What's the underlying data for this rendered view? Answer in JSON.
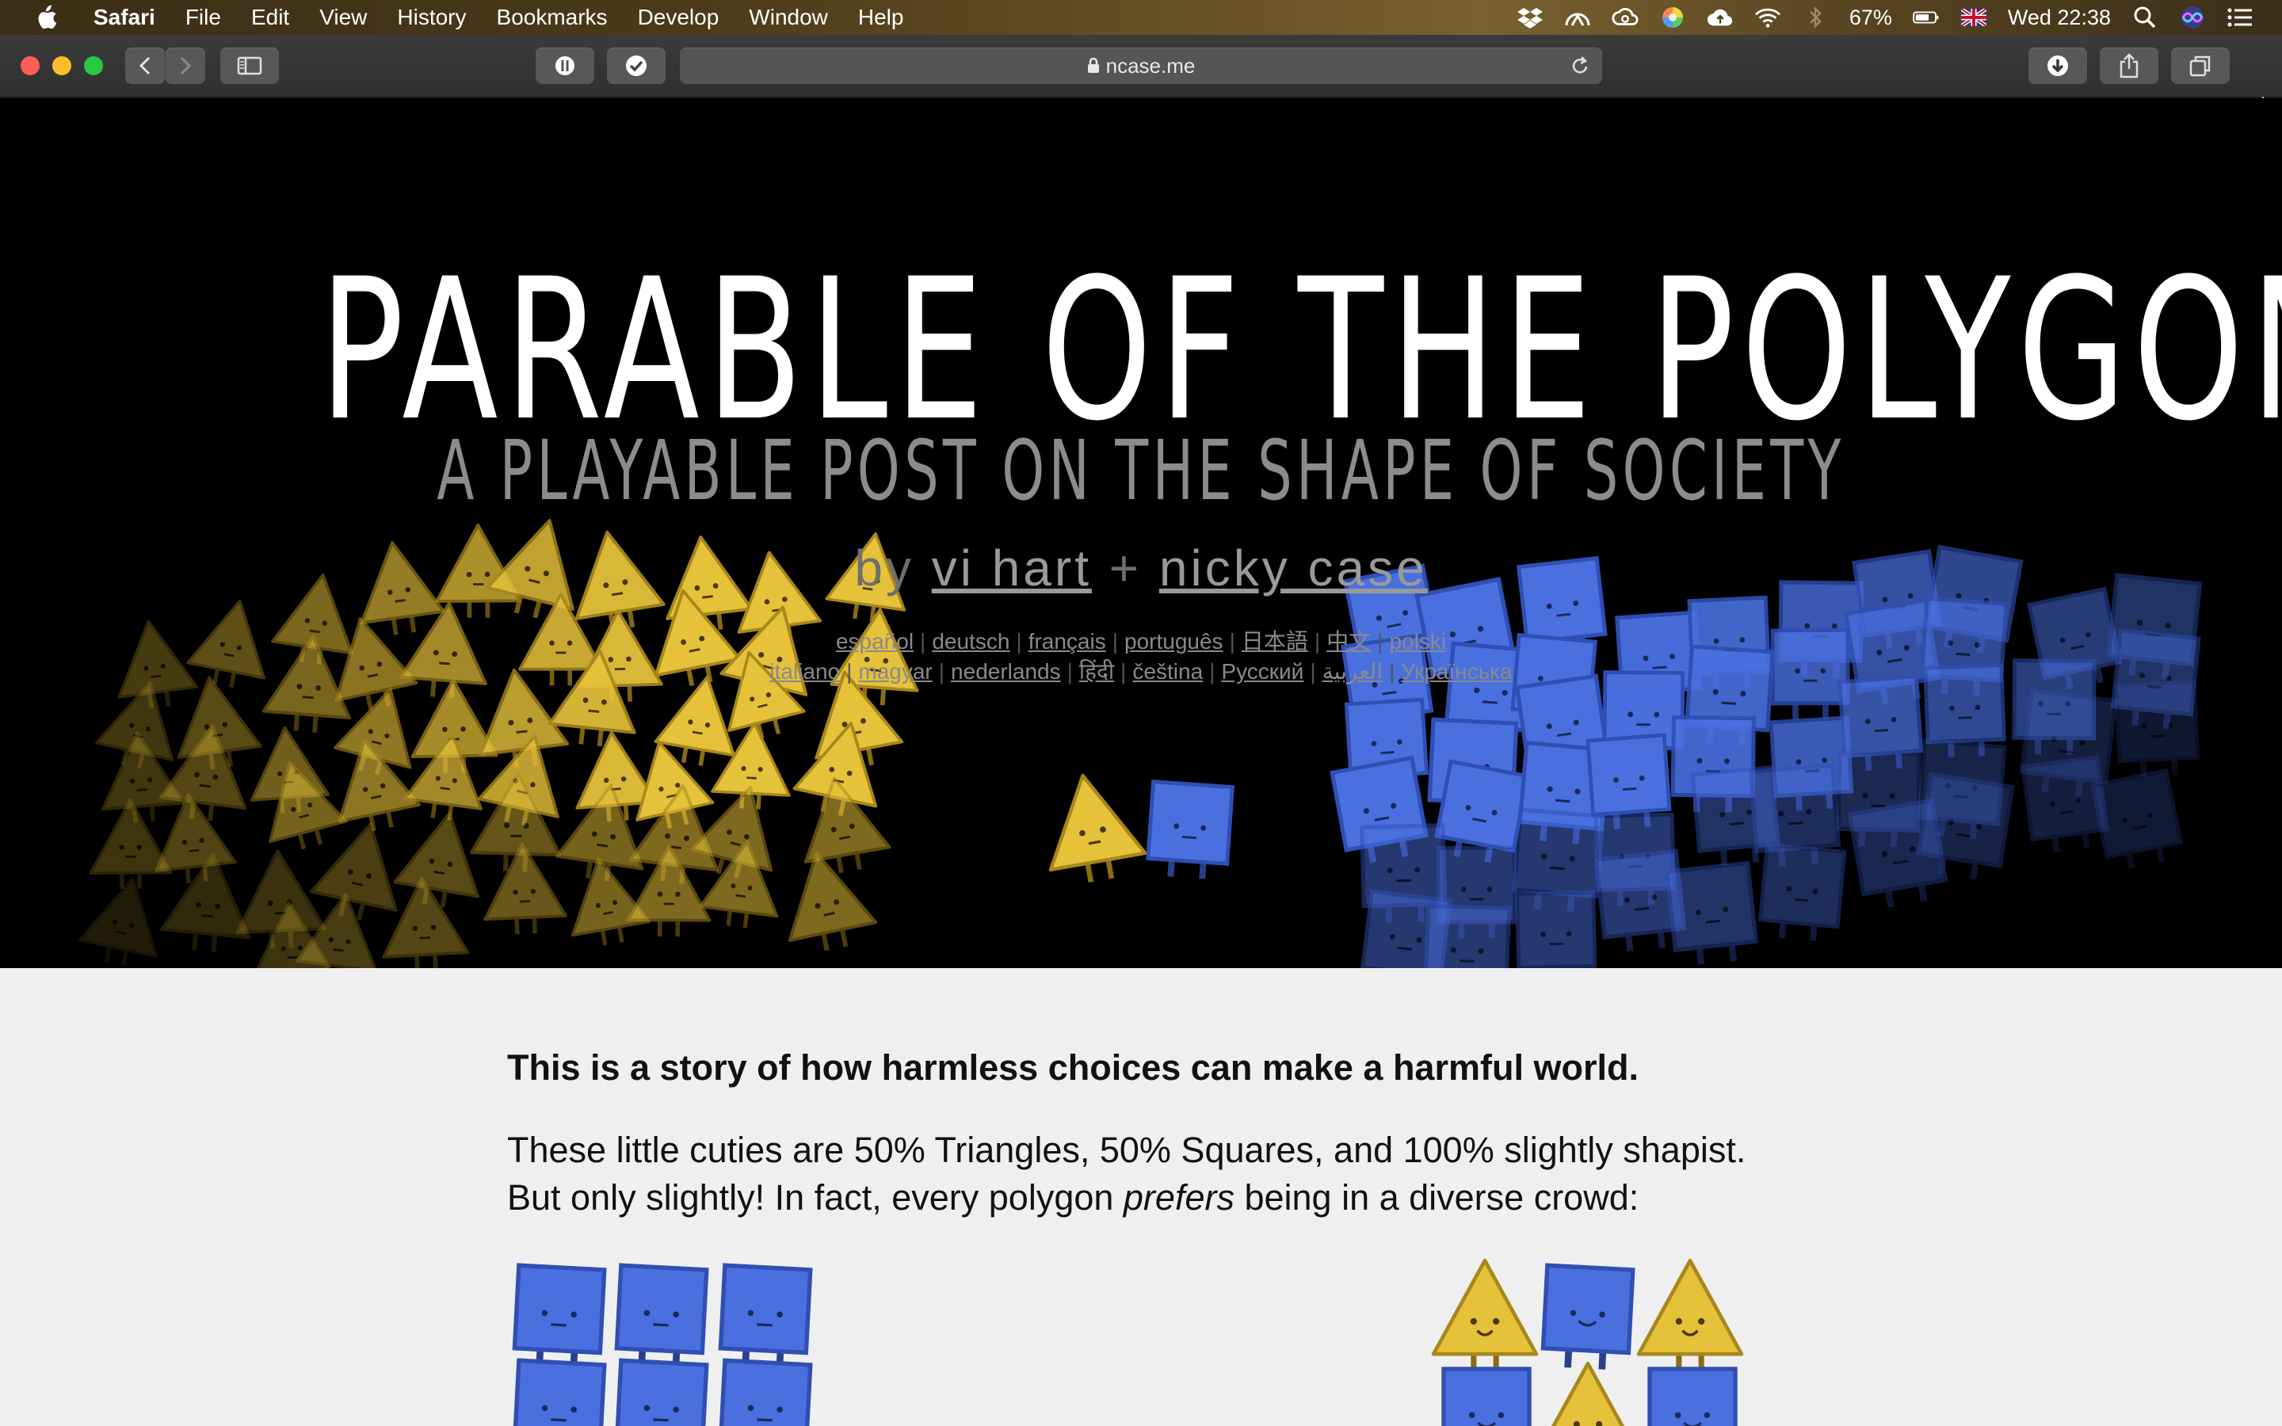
{
  "menubar": {
    "app": "Safari",
    "items": [
      "File",
      "Edit",
      "View",
      "History",
      "Bookmarks",
      "Develop",
      "Window",
      "Help"
    ],
    "battery": "67%",
    "clock": "Wed 22:38"
  },
  "browser": {
    "url": "ncase.me"
  },
  "hero": {
    "title": "PARABLE OF THE POLYGONS",
    "subtitle": "A PLAYABLE POST ON THE SHAPE OF SOCIETY",
    "by": "by",
    "author1": "vi hart",
    "plus": "+",
    "author2": "nicky case",
    "languages_row1": [
      "español",
      "deutsch",
      "français",
      "português",
      "日本語",
      "中文",
      "polski"
    ],
    "languages_row2": [
      "italiano",
      "magyar",
      "nederlands",
      "हिंदी",
      "čeština",
      "Русский",
      "العربية",
      "Українська"
    ]
  },
  "article": {
    "intro": "This is a story of how harmless choices can make a harmful world.",
    "line1": "These little cuties are 50% Triangles, 50% Squares, and 100% slightly shapist.",
    "line2_a": "But only slightly! In fact, every polygon ",
    "line2_em": "prefers",
    "line2_b": " being in a diverse crowd:"
  },
  "colors": {
    "triangle": "#e6c23a",
    "square": "#4a70e0",
    "page_bg": "#efefef"
  }
}
